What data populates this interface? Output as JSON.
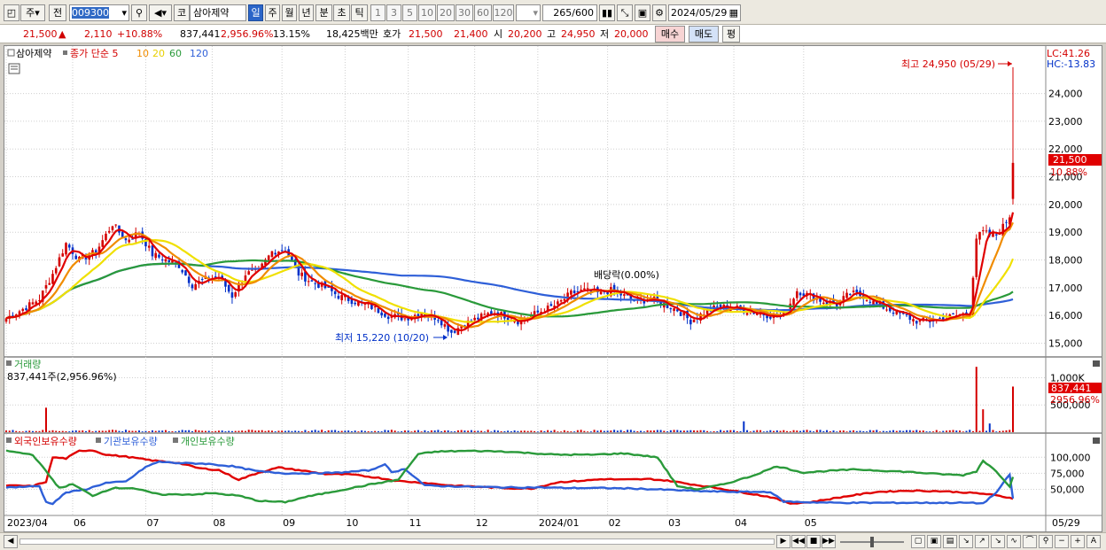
{
  "toolbar": {
    "market_label": "주",
    "prev_label": "전",
    "code": "009300",
    "code_type": "코",
    "stock_name": "삼아제약",
    "periods": [
      "일",
      "주",
      "월",
      "년",
      "분",
      "초",
      "틱"
    ],
    "active_period": "일",
    "intervals": [
      "1",
      "3",
      "5",
      "10",
      "20",
      "30",
      "60",
      "120"
    ],
    "count_current": "265",
    "count_total": "/600",
    "date": "2024/05/29"
  },
  "info": {
    "price": "21,500",
    "up_icon": "▲",
    "change": "2,110",
    "change_pct": "+10.88%",
    "volume": "837,441",
    "volume_pct": "2,956.96%",
    "turnover_pct": "13.15%",
    "amount": "18,425백만",
    "quote_label": "호가",
    "ask": "21,500",
    "bid": "21,400",
    "open_label": "시",
    "open": "20,200",
    "high_label": "고",
    "high": "24,950",
    "low_label": "저",
    "low": "20,000",
    "buy_btn": "매수",
    "sell_btn": "매도",
    "eval_btn": "평"
  },
  "price_panel": {
    "legend_name": "삼아제약",
    "legend_ma": "종가 단순 5",
    "ma_periods": [
      "10",
      "20",
      "60",
      "120"
    ],
    "lc_label": "LC:41.26",
    "hc_label": "HC:-13.83",
    "high_annotation": "최고 24,950 (05/29)",
    "low_annotation": "최저 15,220 (10/20)",
    "dividend_annotation": "배당락(0.00%)",
    "current_price_tag": "21,500",
    "current_pct_tag": "10.88%"
  },
  "volume_panel": {
    "title": "거래량",
    "info": "837,441주(2,956.96%)",
    "current_tag": "837,441",
    "current_pct_tag": "2956.96%"
  },
  "holdings_panel": {
    "series_labels": [
      "외국인보유수량",
      "기관보유수량",
      "개인보유수량"
    ]
  },
  "colors": {
    "up": "#d40000",
    "down": "#0030c8",
    "ma5": "#e00000",
    "ma10": "#f08c00",
    "ma20": "#f0e000",
    "ma60": "#2a9a3a",
    "ma120": "#2e5fd8",
    "foreign": "#e00000",
    "institution": "#2e5fd8",
    "individual": "#2a9a3a"
  },
  "chart_data": [
    {
      "type": "candlestick",
      "title": "삼아제약",
      "x_labels": [
        "2023/04",
        "06",
        "07",
        "08",
        "09",
        "10",
        "11",
        "12",
        "2024/01",
        "02",
        "03",
        "04",
        "05",
        "05/29"
      ],
      "y_ticks": [
        15000,
        16000,
        17000,
        18000,
        19000,
        20000,
        21000,
        22000,
        23000,
        24000
      ],
      "y_tick_labels": [
        "15,000",
        "16,000",
        "17,000",
        "18,000",
        "19,000",
        "20,000",
        "21,000",
        "22,000",
        "23,000",
        "24,000"
      ],
      "ylim": [
        14600,
        25200
      ],
      "grid": true,
      "close_anchors": [
        [
          0,
          15900
        ],
        [
          6,
          16300
        ],
        [
          10,
          16600
        ],
        [
          14,
          17500
        ],
        [
          18,
          18600
        ],
        [
          22,
          18000
        ],
        [
          27,
          18300
        ],
        [
          32,
          19300
        ],
        [
          36,
          18700
        ],
        [
          40,
          19000
        ],
        [
          44,
          18200
        ],
        [
          48,
          18000
        ],
        [
          52,
          17800
        ],
        [
          56,
          17100
        ],
        [
          60,
          17300
        ],
        [
          64,
          17400
        ],
        [
          68,
          16700
        ],
        [
          72,
          17500
        ],
        [
          76,
          17600
        ],
        [
          80,
          18300
        ],
        [
          84,
          18400
        ],
        [
          88,
          17500
        ],
        [
          92,
          17200
        ],
        [
          96,
          17000
        ],
        [
          100,
          16700
        ],
        [
          105,
          16500
        ],
        [
          110,
          16300
        ],
        [
          115,
          16000
        ],
        [
          120,
          15900
        ],
        [
          125,
          16100
        ],
        [
          130,
          15900
        ],
        [
          134,
          15400
        ],
        [
          138,
          15700
        ],
        [
          142,
          15900
        ],
        [
          146,
          16100
        ],
        [
          150,
          16000
        ],
        [
          154,
          15800
        ],
        [
          158,
          16000
        ],
        [
          162,
          16200
        ],
        [
          166,
          16400
        ],
        [
          170,
          16800
        ],
        [
          174,
          16900
        ],
        [
          178,
          16800
        ],
        [
          182,
          16900
        ],
        [
          186,
          16700
        ],
        [
          190,
          16500
        ],
        [
          194,
          16600
        ],
        [
          198,
          16400
        ],
        [
          202,
          16200
        ],
        [
          206,
          15800
        ],
        [
          210,
          16100
        ],
        [
          214,
          16300
        ],
        [
          218,
          16300
        ],
        [
          222,
          16200
        ],
        [
          226,
          16100
        ],
        [
          230,
          16000
        ],
        [
          234,
          16000
        ],
        [
          238,
          16900
        ],
        [
          242,
          16700
        ],
        [
          246,
          16500
        ],
        [
          250,
          16400
        ],
        [
          254,
          16800
        ],
        [
          258,
          16700
        ],
        [
          262,
          16400
        ],
        [
          266,
          16200
        ],
        [
          270,
          16000
        ],
        [
          274,
          15800
        ],
        [
          278,
          15800
        ],
        [
          282,
          15900
        ],
        [
          286,
          16000
        ],
        [
          290,
          16100
        ],
        [
          292,
          18800
        ],
        [
          294,
          19000
        ],
        [
          296,
          18900
        ],
        [
          298,
          18900
        ],
        [
          300,
          19200
        ],
        [
          302,
          19600
        ],
        [
          303,
          21500
        ]
      ],
      "last_candle": {
        "open": 20200,
        "high": 24950,
        "low": 20000,
        "close": 21500
      },
      "moving_averages": [
        "5",
        "10",
        "20",
        "60",
        "120"
      ]
    },
    {
      "type": "bar",
      "title": "거래량",
      "y_ticks": [
        500000,
        1000000
      ],
      "y_tick_labels": [
        "500,000",
        "1,000K"
      ],
      "ylim": [
        0,
        1300000
      ],
      "base_volume": 28000,
      "spikes": [
        [
          12,
          450000
        ],
        [
          222,
          200000
        ],
        [
          292,
          1200000
        ],
        [
          294,
          420000
        ],
        [
          296,
          160000
        ],
        [
          303,
          837441
        ]
      ]
    },
    {
      "type": "line",
      "title": "보유수량",
      "y_ticks": [
        50000,
        75000,
        100000
      ],
      "y_tick_labels": [
        "50,000",
        "75,000",
        "100,000"
      ],
      "ylim": [
        12000,
        117000
      ],
      "series": [
        {
          "name": "외국인보유수량",
          "anchors": [
            [
              0,
              56000
            ],
            [
              8,
              55000
            ],
            [
              12,
              62000
            ],
            [
              14,
              100000
            ],
            [
              18,
              98000
            ],
            [
              22,
              110000
            ],
            [
              26,
              111000
            ],
            [
              30,
              104000
            ],
            [
              36,
              101000
            ],
            [
              44,
              95000
            ],
            [
              52,
              91000
            ],
            [
              58,
              83000
            ],
            [
              64,
              80000
            ],
            [
              70,
              65000
            ],
            [
              76,
              76000
            ],
            [
              82,
              84000
            ],
            [
              88,
              80000
            ],
            [
              96,
              74000
            ],
            [
              104,
              73000
            ],
            [
              112,
              68000
            ],
            [
              118,
              63000
            ],
            [
              126,
              60000
            ],
            [
              134,
              56000
            ],
            [
              142,
              54000
            ],
            [
              150,
              52000
            ],
            [
              158,
              51000
            ],
            [
              166,
              61000
            ],
            [
              172,
              63000
            ],
            [
              180,
              66000
            ],
            [
              186,
              65000
            ],
            [
              194,
              66000
            ],
            [
              200,
              63000
            ],
            [
              206,
              58000
            ],
            [
              214,
              52000
            ],
            [
              222,
              45000
            ],
            [
              230,
              38000
            ],
            [
              236,
              28000
            ],
            [
              242,
              30000
            ],
            [
              248,
              35000
            ],
            [
              254,
              40000
            ],
            [
              262,
              46000
            ],
            [
              272,
              48000
            ],
            [
              282,
              47000
            ],
            [
              292,
              44000
            ],
            [
              296,
              42000
            ],
            [
              303,
              36000
            ]
          ]
        },
        {
          "name": "기관보유수량",
          "anchors": [
            [
              0,
              53000
            ],
            [
              10,
              55000
            ],
            [
              12,
              30000
            ],
            [
              14,
              28000
            ],
            [
              18,
              45000
            ],
            [
              24,
              50000
            ],
            [
              30,
              60000
            ],
            [
              36,
              62000
            ],
            [
              42,
              85000
            ],
            [
              46,
              93000
            ],
            [
              52,
              91000
            ],
            [
              60,
              90000
            ],
            [
              68,
              86000
            ],
            [
              76,
              78000
            ],
            [
              84,
              75000
            ],
            [
              92,
              75000
            ],
            [
              100,
              76000
            ],
            [
              110,
              80000
            ],
            [
              114,
              90000
            ],
            [
              116,
              76000
            ],
            [
              120,
              82000
            ],
            [
              126,
              56000
            ],
            [
              132,
              55000
            ],
            [
              140,
              54000
            ],
            [
              150,
              53000
            ],
            [
              160,
              53000
            ],
            [
              170,
              52000
            ],
            [
              180,
              52000
            ],
            [
              190,
              51000
            ],
            [
              200,
              49000
            ],
            [
              210,
              47000
            ],
            [
              220,
              46000
            ],
            [
              230,
              46000
            ],
            [
              234,
              31000
            ],
            [
              240,
              30000
            ],
            [
              250,
              29000
            ],
            [
              260,
              29000
            ],
            [
              270,
              29000
            ],
            [
              280,
              29000
            ],
            [
              290,
              29000
            ],
            [
              294,
              28000
            ],
            [
              298,
              45000
            ],
            [
              302,
              73000
            ],
            [
              303,
              36000
            ]
          ]
        },
        {
          "name": "개인보유수량",
          "anchors": [
            [
              0,
              110000
            ],
            [
              8,
              104000
            ],
            [
              12,
              78000
            ],
            [
              16,
              52000
            ],
            [
              20,
              58000
            ],
            [
              26,
              40000
            ],
            [
              32,
              52000
            ],
            [
              38,
              52000
            ],
            [
              46,
              42000
            ],
            [
              56,
              42000
            ],
            [
              62,
              44000
            ],
            [
              70,
              40000
            ],
            [
              76,
              32000
            ],
            [
              84,
              30000
            ],
            [
              90,
              38000
            ],
            [
              100,
              48000
            ],
            [
              110,
              58000
            ],
            [
              118,
              65000
            ],
            [
              124,
              105000
            ],
            [
              130,
              109000
            ],
            [
              140,
              110000
            ],
            [
              150,
              109000
            ],
            [
              156,
              107000
            ],
            [
              166,
              104000
            ],
            [
              176,
              104000
            ],
            [
              186,
              106000
            ],
            [
              196,
              100000
            ],
            [
              202,
              55000
            ],
            [
              208,
              50000
            ],
            [
              216,
              58000
            ],
            [
              224,
              70000
            ],
            [
              232,
              86000
            ],
            [
              240,
              76000
            ],
            [
              248,
              79000
            ],
            [
              256,
              81000
            ],
            [
              264,
              79000
            ],
            [
              272,
              77000
            ],
            [
              280,
              74000
            ],
            [
              288,
              72000
            ],
            [
              292,
              78000
            ],
            [
              294,
              95000
            ],
            [
              298,
              78000
            ],
            [
              302,
              55000
            ],
            [
              303,
              70000
            ]
          ]
        }
      ]
    }
  ]
}
